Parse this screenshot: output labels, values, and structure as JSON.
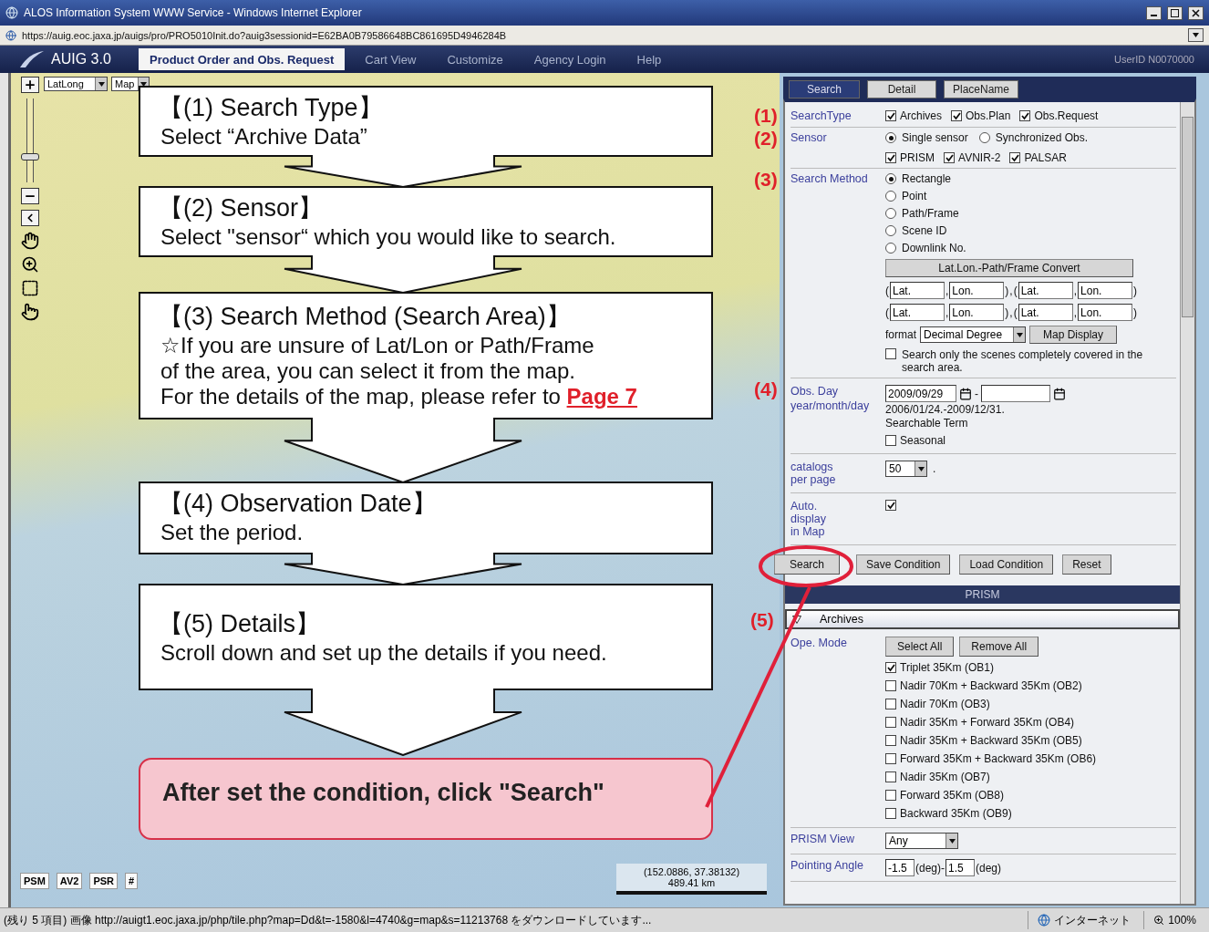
{
  "browser": {
    "title": "ALOS Information System WWW Service - Windows Internet Explorer",
    "address": "https://auig.eoc.jaxa.jp/auigs/pro/PRO5010Init.do?auig3sessionid=E62BA0B79586648BC861695D4946284B",
    "status_text": "(残り 5 項目) 画像 http://auigt1.eoc.jaxa.jp/php/tile.php?map=Dd&t=-1580&l=4740&g=map&s=11213768 をダウンロードしています...",
    "zone": "インターネット",
    "zoom": "100%"
  },
  "app": {
    "logo": "AUIG 3.0",
    "user_id": "UserID N0070000",
    "nav": [
      {
        "label": "Product Order and Obs. Request",
        "selected": true
      },
      {
        "label": "Cart View",
        "selected": false
      },
      {
        "label": "Customize",
        "selected": false
      },
      {
        "label": "Agency Login",
        "selected": false
      },
      {
        "label": "Help",
        "selected": false
      }
    ]
  },
  "map": {
    "coord_system": "LatLong",
    "layer": "Map",
    "zoom_slider": {
      "level": 0.3
    },
    "layer_buttons": [
      "PSM",
      "AV2",
      "PSR",
      "#"
    ],
    "coordinates": "(152.0886, 37.38132)",
    "scale": "489.41 km"
  },
  "callouts": [
    {
      "title": "【(1) Search Type】",
      "lines": [
        {
          "text": "Select “Archive Data”"
        }
      ]
    },
    {
      "title": "【(2) Sensor】",
      "lines": [
        {
          "text": "Select \"sensor“ which you would like to search."
        }
      ]
    },
    {
      "title": "【(3) Search Method (Search Area)】",
      "lines": [
        {
          "text": "☆If you are unsure of Lat/Lon or Path/Frame"
        },
        {
          "text": "of the area, you can select it from the map."
        },
        {
          "text": "For the details of the map, please refer to",
          "link": "Page 7"
        }
      ]
    },
    {
      "title": "【(4) Observation Date】",
      "lines": [
        {
          "text": "Set the period."
        }
      ]
    },
    {
      "title": "【(5) Details】",
      "lines": [
        {
          "text": "Scroll down and set up the details if you need."
        }
      ]
    }
  ],
  "final_note": "After set the condition, click \"Search\"",
  "panel": {
    "tabs": [
      {
        "label": "Search",
        "selected": true
      },
      {
        "label": "Detail",
        "selected": false
      },
      {
        "label": "PlaceName",
        "selected": false
      }
    ],
    "search_type": {
      "marker": "(1)",
      "label": "SearchType",
      "options": [
        {
          "label": "Archives",
          "checked": true
        },
        {
          "label": "Obs.Plan",
          "checked": true
        },
        {
          "label": "Obs.Request",
          "checked": true
        }
      ]
    },
    "sensor": {
      "marker": "(2)",
      "label": "Sensor",
      "modes": [
        {
          "label": "Single sensor",
          "selected": true
        },
        {
          "label": "Synchronized Obs.",
          "selected": false
        }
      ],
      "sensors": [
        {
          "label": "PRISM",
          "checked": true
        },
        {
          "label": "AVNIR-2",
          "checked": true
        },
        {
          "label": "PALSAR",
          "checked": true
        }
      ]
    },
    "search_method": {
      "marker": "(3)",
      "label": "Search Method",
      "methods": [
        {
          "label": "Rectangle",
          "selected": true
        },
        {
          "label": "Point",
          "selected": false
        },
        {
          "label": "Path/Frame",
          "selected": false
        },
        {
          "label": "Scene ID",
          "selected": false
        },
        {
          "label": "Downlink No.",
          "selected": false
        }
      ],
      "convert_button": "Lat.Lon.-Path/Frame Convert",
      "pair_open": "(",
      "pair_sep": ",",
      "pair_close": ")",
      "pair_join": ",",
      "coordinate_rows": [
        [
          [
            "Lat.",
            "Lon."
          ],
          [
            "Lat.",
            "Lon."
          ]
        ],
        [
          [
            "Lat.",
            "Lon."
          ],
          [
            "Lat.",
            "Lon."
          ]
        ]
      ],
      "format_label": "format",
      "format": "Decimal Degree",
      "map_button": "Map Display",
      "covered_only": {
        "label": "Search only the scenes completely covered in the search area.",
        "checked": false
      }
    },
    "obs_day": {
      "marker": "(4)",
      "label": "Obs. Day",
      "sublabel": "year/month/day",
      "from": "2009/09/29",
      "separator": "-",
      "term": "2006/01/24.-2009/12/31.",
      "term_label": "Searchable Term",
      "seasonal": {
        "label": "Seasonal",
        "checked": false
      }
    },
    "catalogs": {
      "label": "catalogs per page",
      "value": "50",
      "suffix": "."
    },
    "auto_display": {
      "label": "Auto. display in Map",
      "checked": true
    },
    "actions": [
      "Search",
      "Save Condition",
      "Load Condition",
      "Reset"
    ],
    "section": "PRISM",
    "archives": {
      "marker": "(5)",
      "label": "Archives",
      "expanded": true
    },
    "ope_mode": {
      "label": "Ope. Mode",
      "buttons": [
        "Select All",
        "Remove All"
      ],
      "modes": [
        {
          "label": "Triplet 35Km (OB1)",
          "checked": true
        },
        {
          "label": "Nadir 70Km + Backward 35Km (OB2)",
          "checked": false
        },
        {
          "label": "Nadir 70Km (OB3)",
          "checked": false
        },
        {
          "label": "Nadir 35Km + Forward 35Km (OB4)",
          "checked": false
        },
        {
          "label": "Nadir 35Km + Backward 35Km (OB5)",
          "checked": false
        },
        {
          "label": "Forward 35Km + Backward 35Km (OB6)",
          "checked": false
        },
        {
          "label": "Nadir 35Km (OB7)",
          "checked": false
        },
        {
          "label": "Forward 35Km (OB8)",
          "checked": false
        },
        {
          "label": "Backward 35Km (OB9)",
          "checked": false
        }
      ]
    },
    "prism_view": {
      "label": "PRISM View",
      "value": "Any"
    },
    "pointing_angle": {
      "label": "Pointing Angle",
      "from": "-1.5",
      "from_unit": "(deg)-",
      "to": "1.5",
      "to_unit": "(deg)"
    }
  }
}
